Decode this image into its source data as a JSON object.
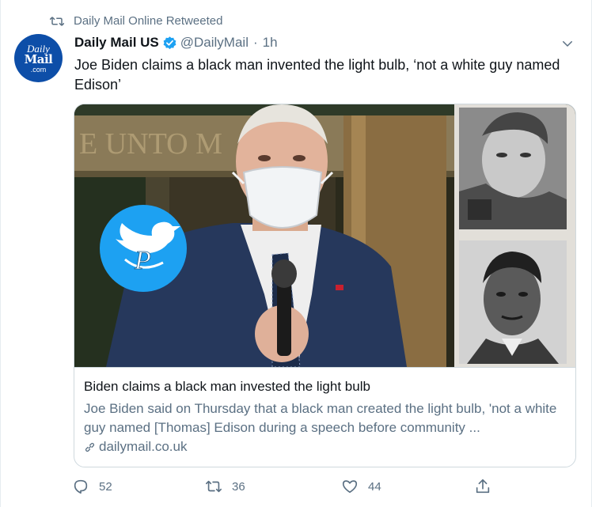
{
  "retweet": {
    "text": "Daily Mail Online Retweeted",
    "icon": "retweet-icon"
  },
  "author": {
    "avatar_lines": [
      "Daily",
      "Mail",
      ".com"
    ],
    "name": "Daily Mail US",
    "handle": "@DailyMail",
    "separator": "·",
    "time": "1h",
    "verified": true,
    "verified_color": "#1da1f2"
  },
  "tweet_text": "Joe Biden claims a black man invented the light bulb, ‘not a white guy named Edison’",
  "media": {
    "wall_sign_text": "E UNTO M"
  },
  "card": {
    "title": "Biden claims a black man invested the light bulb",
    "description": "Joe Biden said on Thursday that a black man created the light bulb, 'not a white guy named [Thomas] Edison during a speech before community ...",
    "domain": "dailymail.co.uk"
  },
  "actions": {
    "reply_count": "52",
    "retweet_count": "36",
    "like_count": "44"
  },
  "colors": {
    "text_secondary": "#5b7083",
    "avatar_bg": "#0d4ea8",
    "twitter_blue": "#1da1f2"
  }
}
